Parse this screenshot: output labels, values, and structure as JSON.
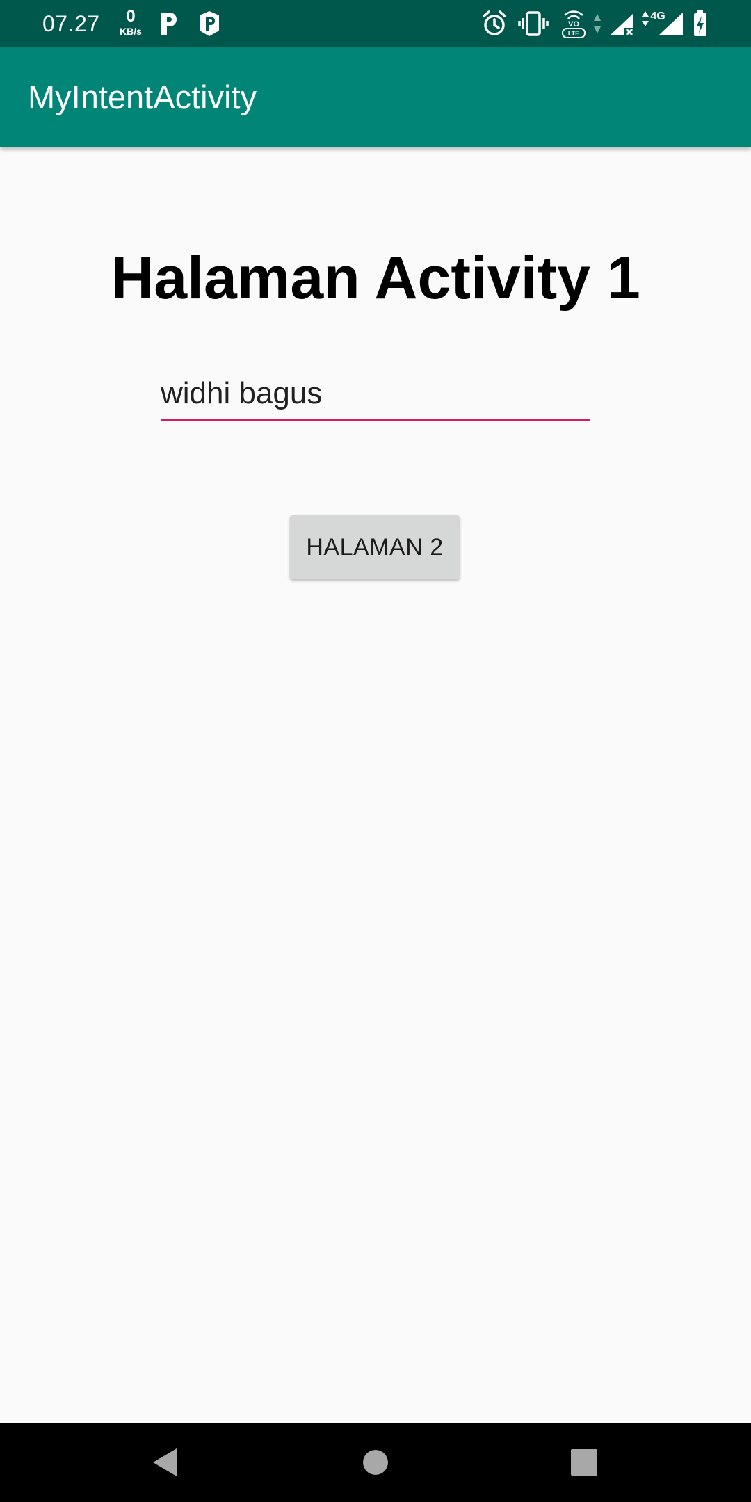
{
  "status_bar": {
    "time": "07.27",
    "net_speed_value": "0",
    "net_speed_unit": "KB/s",
    "left_icons": [
      "parking-icon",
      "parking-shield-icon"
    ],
    "right_icons": [
      "alarm-icon",
      "vibrate-icon",
      "volte-icon",
      "data-arrows-icon",
      "signal-no-service-icon",
      "signal-4g-icon",
      "battery-charging-icon"
    ],
    "network_label": "4G",
    "volte_label_top": "VO",
    "volte_label_bottom": "LTE"
  },
  "app_bar": {
    "title": "MyIntentActivity"
  },
  "main": {
    "heading": "Halaman Activity 1",
    "name_input_value": "widhi bagus",
    "next_button_label": "HALAMAN 2"
  },
  "nav_bar": {
    "icons": [
      "back-icon",
      "home-icon",
      "recents-icon"
    ]
  },
  "colors": {
    "status_bar": "#00574b",
    "app_bar": "#008577",
    "accent": "#d81b60",
    "background": "#fafafa",
    "button": "#d6d7d7"
  }
}
